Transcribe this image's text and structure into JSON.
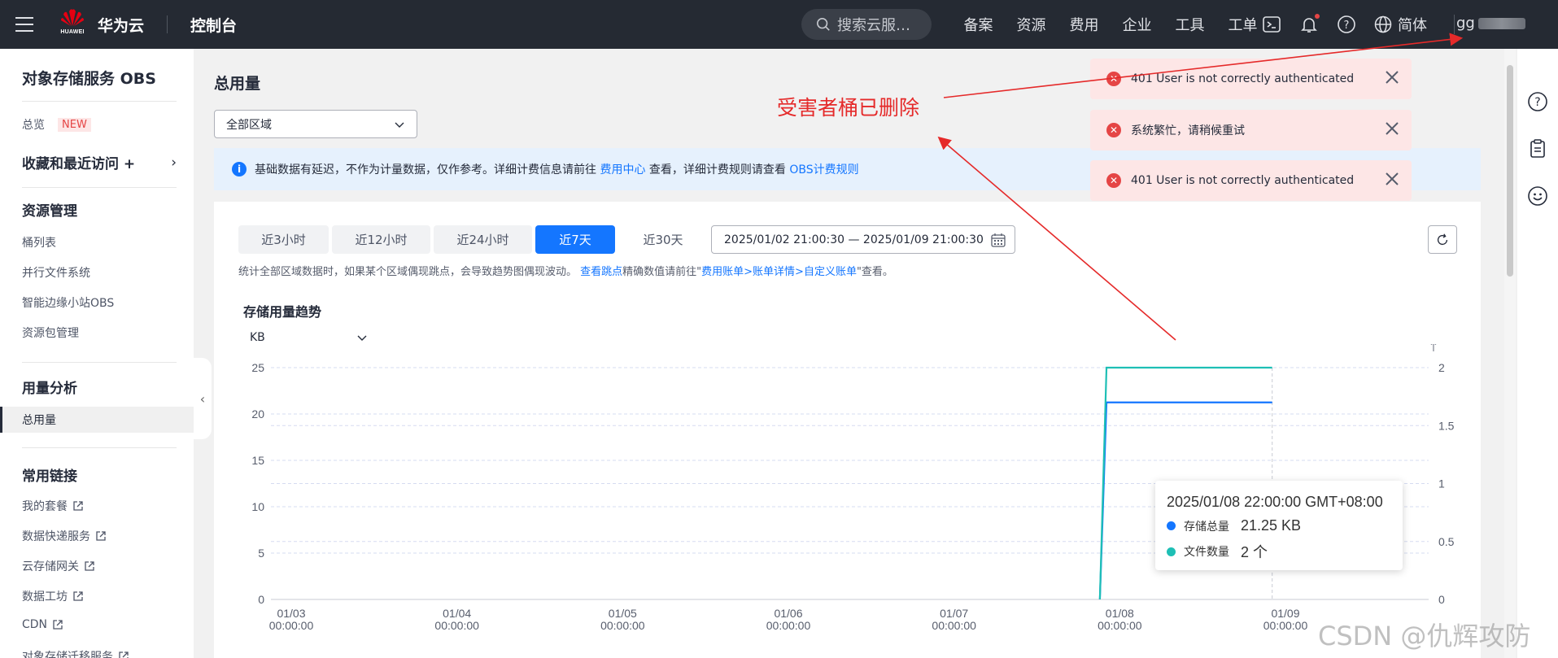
{
  "topbar": {
    "brand_sub": "HUAWEI",
    "brand": "华为云",
    "console": "控制台",
    "search_placeholder": "搜索云服…",
    "nav": [
      "备案",
      "资源",
      "费用",
      "企业",
      "工具",
      "工单"
    ],
    "lang": "简体",
    "user": "gg"
  },
  "sidebar": {
    "title": "对象存储服务 OBS",
    "overview": "总览",
    "new_badge": "NEW",
    "favorites": "收藏和最近访问 +",
    "resource_head": "资源管理",
    "resource_items": [
      "桶列表",
      "并行文件系统",
      "智能边缘小站OBS",
      "资源包管理"
    ],
    "usage_head": "用量分析",
    "usage_item": "总用量",
    "links_head": "常用链接",
    "links": [
      "我的套餐",
      "数据快递服务",
      "云存储网关",
      "数据工坊",
      "CDN",
      "对象存储迁移服务"
    ]
  },
  "main": {
    "title": "总用量",
    "region": "全部区域",
    "info_text_1": "基础数据有延迟，不作为计量数据，仅作参考。详细计费信息请前往",
    "info_link_1": "费用中心",
    "info_text_2": "查看，详细计费规则请查看",
    "info_link_2": "OBS计费规则",
    "time_tabs": [
      "近3小时",
      "近12小时",
      "近24小时",
      "近7天",
      "近30天"
    ],
    "active_tab": "近7天",
    "date_range": "2025/01/02 21:00:30 — 2025/01/09 21:00:30",
    "note_text": "统计全部区域数据时，如果某个区域偶现跳点，会导致趋势图偶现波动。",
    "note_link_1": "查看跳点",
    "note_text_2": "精确数值请前往\"",
    "note_link_2": "费用账单>账单详情>自定义账单",
    "note_text_3": "\"查看。",
    "chart_title": "存储用量趋势",
    "unit": "KB"
  },
  "chart_data": {
    "type": "line",
    "x": [
      "01/03 00:00:00",
      "01/04 00:00:00",
      "01/05 00:00:00",
      "01/06 00:00:00",
      "01/07 00:00:00",
      "01/08 00:00:00",
      "01/09 00:00:00"
    ],
    "x_ticks_date": [
      "01/03",
      "01/04",
      "01/05",
      "01/06",
      "01/07",
      "01/08",
      "01/09"
    ],
    "x_ticks_time": [
      "00:00:00",
      "00:00:00",
      "00:00:00",
      "00:00:00",
      "00:00:00",
      "00:00:00",
      "00:00:00"
    ],
    "y_left_ticks": [
      "0",
      "5",
      "10",
      "15",
      "20",
      "25"
    ],
    "y_right_ticks": [
      "0",
      "0.5",
      "1",
      "1.5",
      "2"
    ],
    "ylim_left": [
      0,
      25
    ],
    "ylim_right": [
      0,
      2
    ],
    "series": [
      {
        "name": "存储总量",
        "color": "#1476ff",
        "axis": "left",
        "points": [
          [
            4.88,
            0
          ],
          [
            4.92,
            21.25
          ],
          [
            5.92,
            21.25
          ]
        ]
      },
      {
        "name": "文件数量",
        "color": "#1ebfb5",
        "axis": "right",
        "points": [
          [
            4.88,
            0
          ],
          [
            4.92,
            2
          ],
          [
            5.92,
            2
          ]
        ]
      }
    ],
    "tooltip": {
      "time": "2025/01/08 22:00:00 GMT+08:00",
      "rows": [
        {
          "name": "存储总量",
          "value": "21.25 KB",
          "color": "#1476ff"
        },
        {
          "name": "文件数量",
          "value": "2 个",
          "color": "#1ebfb5"
        }
      ]
    }
  },
  "toasts": [
    "401 User is not correctly authenticated",
    "系统繁忙，请稍候重试",
    "401 User is not correctly authenticated"
  ],
  "annotation": "受害者桶已删除",
  "watermark": "CSDN @仇辉攻防"
}
